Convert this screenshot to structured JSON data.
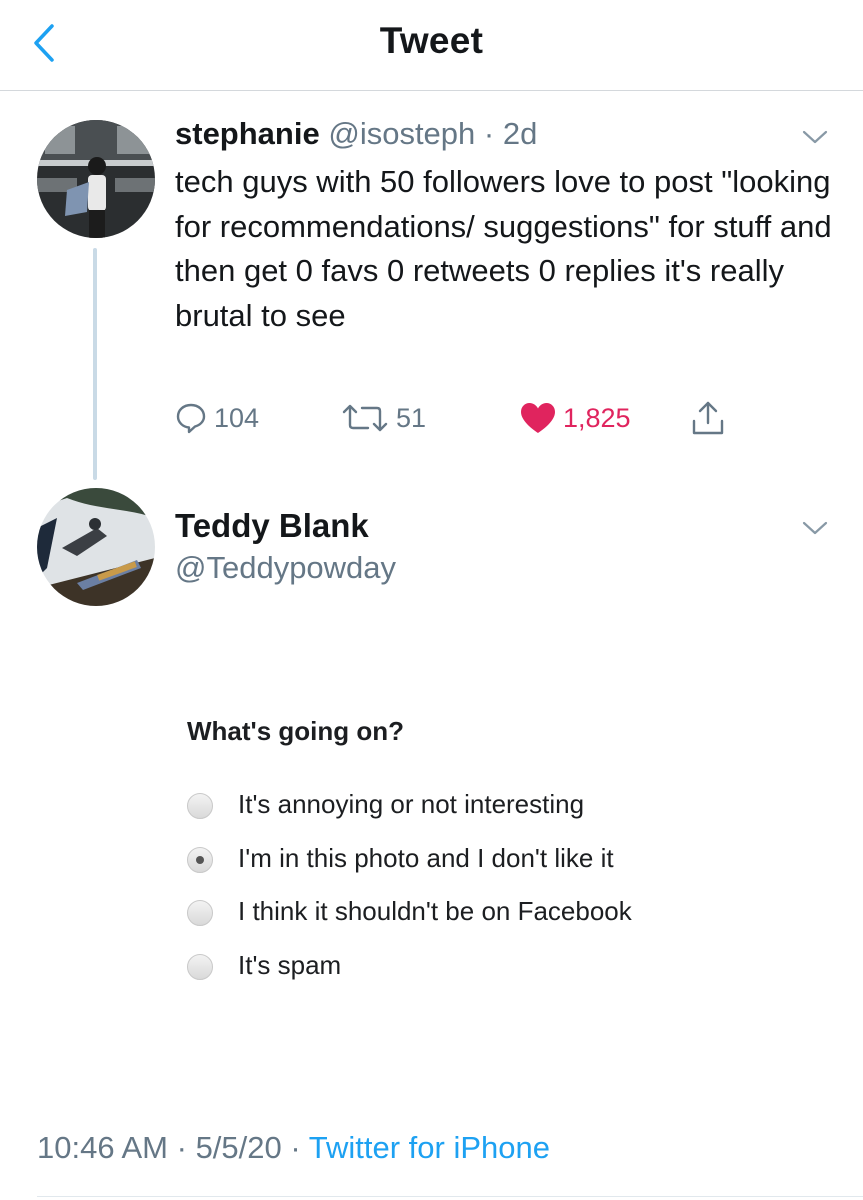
{
  "header": {
    "title": "Tweet",
    "back_icon": "chevron-left-icon",
    "accent_color": "#1da1f2"
  },
  "tweet": {
    "display_name": "stephanie",
    "handle": "@isosteph",
    "dot": "·",
    "time": "2d",
    "text": "tech guys with 50 followers love to post \"looking for recommendations/ suggestions\" for stuff and then get 0 favs 0 retweets 0 replies it's really brutal to see",
    "actions": {
      "reply_count": "104",
      "retweet_count": "51",
      "like_count": "1,825",
      "liked": true,
      "like_color": "#e0245e"
    }
  },
  "reply": {
    "display_name": "Teddy Blank",
    "handle": "@Teddypowday",
    "embedded": {
      "question": "What's going on?",
      "options": [
        {
          "label": "It's annoying or not interesting",
          "checked": false
        },
        {
          "label": "I'm in this photo and I don't like it",
          "checked": true
        },
        {
          "label": "I think it shouldn't be on Facebook",
          "checked": false
        },
        {
          "label": "It's spam",
          "checked": false
        }
      ]
    },
    "footer": {
      "time": "10:46 AM",
      "sep1": "·",
      "date": "5/5/20",
      "sep2": "·",
      "source": "Twitter for iPhone"
    }
  }
}
